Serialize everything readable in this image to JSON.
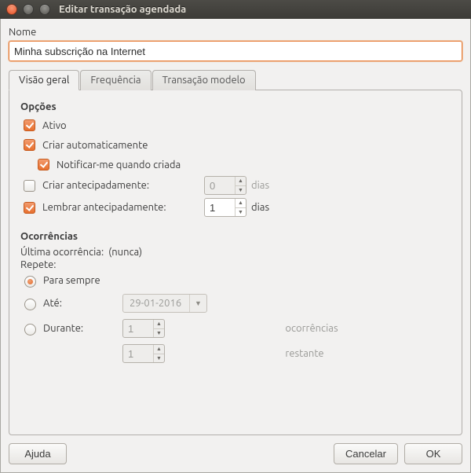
{
  "window": {
    "title": "Editar transação agendada"
  },
  "name": {
    "label": "Nome",
    "value": "Minha subscrição na Internet"
  },
  "tabs": {
    "overview": "Visão geral",
    "frequency": "Frequência",
    "template": "Transação modelo"
  },
  "options": {
    "heading": "Opções",
    "active": "Ativo",
    "auto_create": "Criar automaticamente",
    "notify_created": "Notificar-me quando criada",
    "create_early": "Criar antecipadamente:",
    "create_early_value": "0",
    "remind_early": "Lembrar antecipadamente:",
    "remind_early_value": "1",
    "days_unit": "dias"
  },
  "occurrences": {
    "heading": "Ocorrências",
    "last_label": "Última ocorrência:",
    "last_value": "(nunca)",
    "repeat_label": "Repete:",
    "forever": "Para sempre",
    "until": "Até:",
    "until_date": "29-01-2016",
    "during": "Durante:",
    "during_value": "1",
    "during_unit": "ocorrências",
    "remaining_value": "1",
    "remaining_unit": "restante"
  },
  "buttons": {
    "help": "Ajuda",
    "cancel": "Cancelar",
    "ok": "OK"
  }
}
